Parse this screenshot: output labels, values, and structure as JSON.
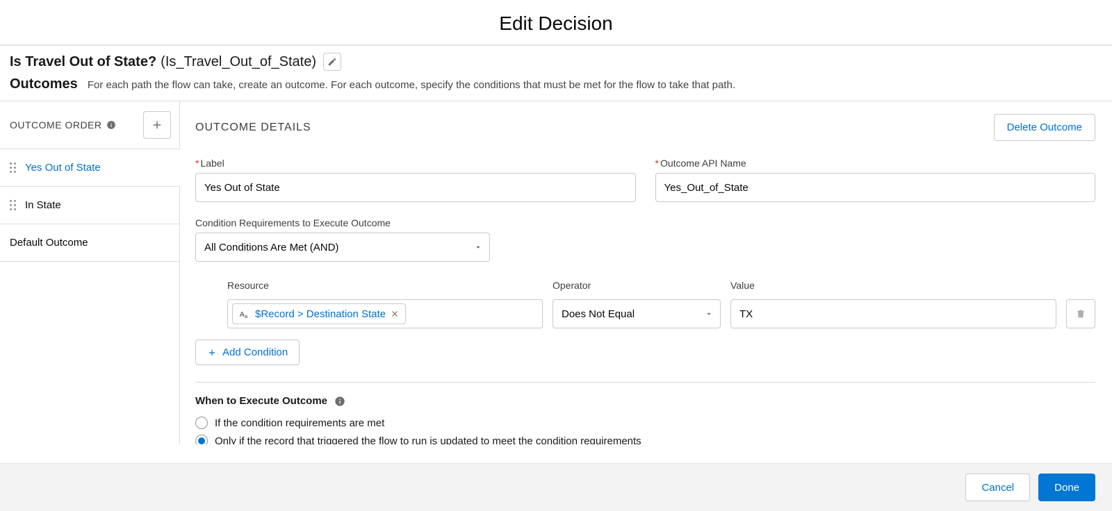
{
  "modal": {
    "title": "Edit Decision"
  },
  "decision": {
    "name": "Is Travel Out of State?",
    "api_name": "(Is_Travel_Out_of_State)"
  },
  "outcomes": {
    "heading": "Outcomes",
    "help": "For each path the flow can take, create an outcome. For each outcome, specify the conditions that must be met for the flow to take that path."
  },
  "sidebar": {
    "title": "OUTCOME ORDER",
    "items": [
      {
        "label": "Yes Out of State",
        "selected": true,
        "draggable": true
      },
      {
        "label": "In State",
        "selected": false,
        "draggable": true
      }
    ],
    "default_label": "Default Outcome"
  },
  "details": {
    "title": "OUTCOME DETAILS",
    "delete_label": "Delete Outcome",
    "label_field": {
      "label": "Label",
      "value": "Yes Out of State"
    },
    "api_field": {
      "label": "Outcome API Name",
      "value": "Yes_Out_of_State"
    },
    "cond_req": {
      "label": "Condition Requirements to Execute Outcome",
      "value": "All Conditions Are Met (AND)"
    },
    "condition_row": {
      "resource_label": "Resource",
      "resource_pill": "$Record > Destination State",
      "operator_label": "Operator",
      "operator_value": "Does Not Equal",
      "value_label": "Value",
      "value_value": "TX"
    },
    "add_condition": "Add Condition",
    "when": {
      "title": "When to Execute Outcome",
      "opt1": "If the condition requirements are met",
      "opt2": "Only if the record that triggered the flow to run is updated to meet the condition requirements",
      "selected": 1
    }
  },
  "footer": {
    "cancel": "Cancel",
    "done": "Done"
  }
}
